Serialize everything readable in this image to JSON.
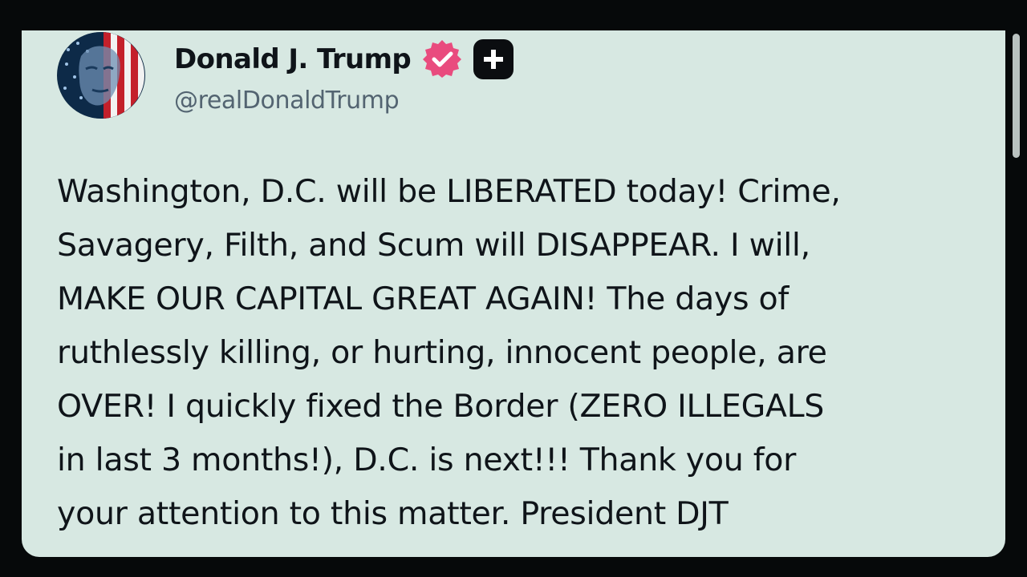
{
  "post": {
    "author": {
      "display_name": "Donald J. Trump",
      "handle": "@realDonaldTrump",
      "avatar_icon": "flag-portrait-avatar",
      "verified_icon": "verified-badge-icon",
      "plus_icon": "plus-badge-icon"
    },
    "text_lines": [
      "Washington, D.C. will be LIBERATED today! Crime,",
      "Savagery, Filth, and Scum will DISAPPEAR. I will,",
      "MAKE OUR CAPITAL GREAT AGAIN! The days of",
      "ruthlessly killing, or hurting, innocent people, are",
      "OVER! I quickly fixed the Border (ZERO ILLEGALS",
      "in last 3 months!), D.C. is next!!! Thank you for",
      "your attention to this matter. President DJT"
    ]
  },
  "colors": {
    "card_background": "#d7e8e2",
    "page_background": "#06090a",
    "verified_badge": "#e94b7e",
    "text_primary": "#0f1419",
    "text_secondary": "#536471"
  }
}
